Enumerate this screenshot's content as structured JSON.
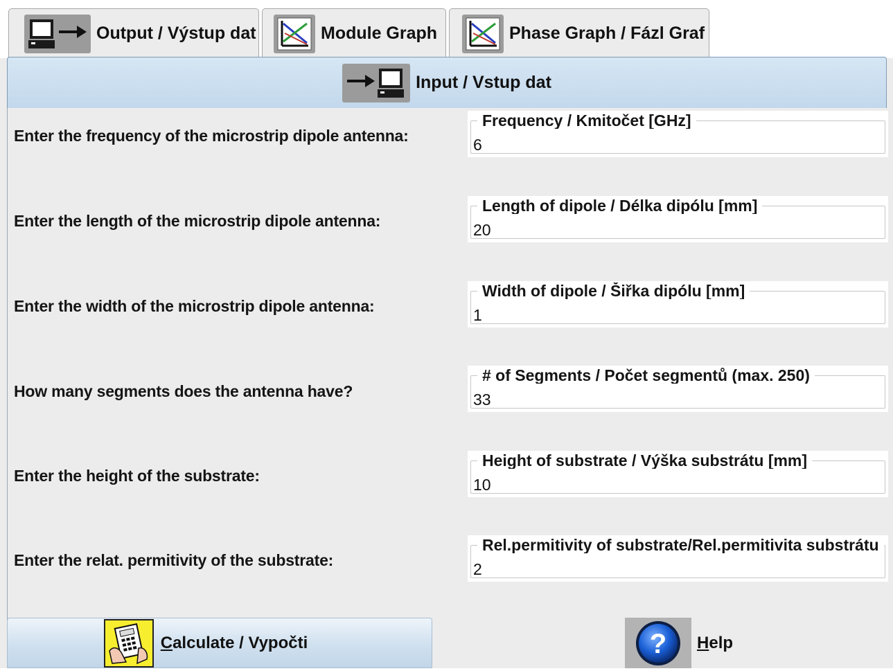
{
  "tabs": [
    {
      "label": "Output / Výstup dat",
      "icon": "computer-arrow-output-icon"
    },
    {
      "label": "Module Graph",
      "icon": "graph-icon"
    },
    {
      "label": "Phase Graph / Fázl Graf",
      "icon": "graph-icon"
    }
  ],
  "selected_tab": {
    "label": "Input / Vstup dat",
    "icon": "arrow-computer-input-icon"
  },
  "rows": [
    {
      "prompt": "Enter the frequency of the microstrip dipole antenna:",
      "legend": "Frequency / Kmitočet [GHz]",
      "value": "6"
    },
    {
      "prompt": "Enter the length of the microstrip dipole antenna:",
      "legend": "Length of dipole / Délka dipólu [mm]",
      "value": "20"
    },
    {
      "prompt": "Enter the width of the microstrip dipole antenna:",
      "legend": "Width of dipole / Šiřka dipólu [mm]",
      "value": "1"
    },
    {
      "prompt": "How many segments does the antenna have?",
      "legend": "# of Segments / Počet segmentů  (max. 250)",
      "value": "33"
    },
    {
      "prompt": "Enter the height of the substrate:",
      "legend": "Height of substrate / Výška substrátu [mm]",
      "value": "10"
    },
    {
      "prompt": "Enter the relat. permitivity of the substrate:",
      "legend": "Rel.permitivity of substrate/Rel.permitivita substrátu",
      "value": "2"
    }
  ],
  "buttons": {
    "calculate": {
      "mnemonic": "C",
      "rest": "alculate / Vypočti",
      "icon": "calculator-hand-icon"
    },
    "help": {
      "mnemonic": "H",
      "rest": "elp",
      "icon": "question-mark-icon"
    }
  },
  "colors": {
    "selected_tab": "#c3d8ec",
    "calculate_button": "#cfe0ef",
    "help_icon": "#1a5fd6",
    "graph_lines": [
      "#c0392b",
      "#2e9e3a",
      "#2a3fbf"
    ]
  }
}
